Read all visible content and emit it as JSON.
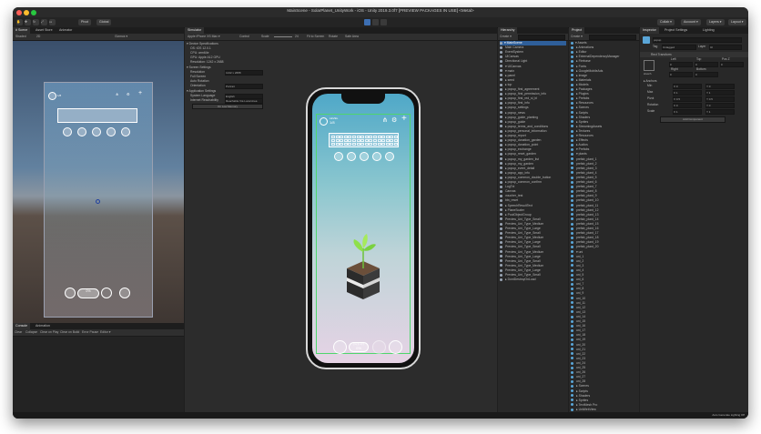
{
  "window": {
    "title": "MainScene - SolarPlanet_UnityWork - iOS - Unity 2019.3.0f7 [PREVIEW PACKAGES IN USE] <Metal>"
  },
  "toolbar": {
    "pivot": "Pivot",
    "global": "Global",
    "collab": "Collab ▾",
    "account": "Account ▾",
    "layers": "Layers ▾",
    "layout": "Layout ▾"
  },
  "scene_tabs": [
    "# Scene",
    "Asset Store",
    "Animator"
  ],
  "scene_sub": {
    "shaded": "Shaded",
    "mode": "2D",
    "gizmos": "Gizmos ▾"
  },
  "game_panel": {
    "tab": "Simulator",
    "device": "Apple iPhone XS Max ▾",
    "control": "Control",
    "scale_label": "Scale",
    "scale_value": "24",
    "fit_label": "Fit to Screen",
    "rotate": "Rotate",
    "safe_area": "Safe Area",
    "section_spec": "▾ Device Specifications",
    "specs": [
      "OS: iOS 12.0.1",
      "CPU: arm64e",
      "GPU: Apple A12 GPU",
      "Resolution: 1242 x 2688"
    ],
    "section_screen": "▾ Screen Settings",
    "screen_rows": [
      {
        "k": "Resolution",
        "v": "1242 x 2688"
      },
      {
        "k": "Full Screen",
        "v": ""
      },
      {
        "k": "Auto Rotation",
        "v": ""
      },
      {
        "k": "Orientation",
        "v": "Portrait"
      }
    ],
    "section_app": "▾ Application Settings",
    "app_rows": [
      {
        "k": "System Language",
        "v": "English"
      },
      {
        "k": "Internet Reachability",
        "v": "Reachable Via Local Area"
      }
    ],
    "low_memory": "On Low Memory"
  },
  "hierarchy": {
    "tab": "Hierarchy",
    "create": "Create ▾",
    "items": [
      "▾ MainScene",
      "  Main Camera",
      "  EventSystem",
      "  UICanvas",
      "  Directional Light",
      "  ▾ UICanvas",
      "    ▾ main",
      "      ▸ panel",
      "      ▸ seed",
      "      ▸ top",
      "      ▸ popup_first_agreement",
      "      ▸ popup_first_permission_info",
      "      ▸ popup_first_red_sl_bl",
      "      ▸ popup_first_info",
      "      ▸ popup_settings",
      "      ▸ popup_news",
      "      ▸ popup_guide_planting",
      "      ▸ popup_guide",
      "      ▸ popup_terms_and_conditions",
      "      ▸ popup_personal_information",
      "      ▸ popup_report",
      "      ▸ popup_donation_garden",
      "      ▸ popup_donation_point",
      "      ▸ popup_exchange",
      "      ▸ popup_reset_garden",
      "      ▸ popup_my_garden_list",
      "      ▸ popup_my_garden",
      "      ▸ popup_event_detail",
      "      ▸ popup_app_info",
      "      ▸ popup_common_double_button",
      "      ▸ popup_common_confirm",
      "      LogTxt",
      "    Canvas",
      "      voucher_test",
      "      btn_reset",
      "  ▸ SpeechResultText",
      "  ▸ PlaneScaler",
      "  ▸ PoolObjectGroup",
      "    Preview_Uni_Type_Small",
      "    Preview_Uni_Type_Medium",
      "    Preview_Uni_Type_Large",
      "    Preview_Uni_Type_Small",
      "    Preview_Uni_Type_Medium",
      "    Preview_Uni_Type_Large",
      "    Preview_Uni_Type_Small",
      "    Preview_Uni_Type_Medium",
      "    Preview_Uni_Type_Large",
      "    Preview_Uni_Type_Small",
      "    Preview_Uni_Type_Medium",
      "    Preview_Uni_Type_Large",
      "    Preview_Uni_Type_Small",
      "  ▸ DontDestroyOnLoad"
    ]
  },
  "project": {
    "tab": "Project",
    "create": "Create ▾",
    "items": [
      "▾ Assets",
      "  ▸ Animations",
      "  ▸ Editor",
      "  ▸ ExternalDependencyManager",
      "  ▸ Firebase",
      "  ▸ Fonts",
      "  ▸ GoogleMobileAds",
      "  ▸ Image",
      "  ▸ Materials",
      "  ▸ Models",
      "  ▸ Packages",
      "  ▸ Plugins",
      "  ▸ Prefabs",
      "  ▸ Resources",
      "  ▸ Scenes",
      "  ▸ Scripts",
      "  ▸ Shaders",
      "  ▸ Sprites",
      "  ▸ StreamingAssets",
      "  ▸ Textures",
      "  ▾ Resources",
      "    ▸ Effects",
      "    ▸ Audios",
      "    ▾ Prefabs",
      "      ▾ plants",
      "        prefab_plant_1",
      "        prefab_plant_2",
      "        prefab_plant_3",
      "        prefab_plant_4",
      "        prefab_plant_5",
      "        prefab_plant_6",
      "        prefab_plant_7",
      "        prefab_plant_8",
      "        prefab_plant_9",
      "        prefab_plant_10",
      "        prefab_plant_11",
      "        prefab_plant_12",
      "        prefab_plant_13",
      "        prefab_plant_14",
      "        prefab_plant_15",
      "        prefab_plant_16",
      "        prefab_plant_17",
      "        prefab_plant_18",
      "        prefab_plant_19",
      "        prefab_plant_20",
      "      ▾ uni",
      "        uni_1",
      "        uni_2",
      "        uni_3",
      "        uni_4",
      "        uni_5",
      "        uni_6",
      "        uni_7",
      "        uni_8",
      "        uni_9",
      "        uni_10",
      "        uni_11",
      "        uni_12",
      "        uni_13",
      "        uni_14",
      "        uni_15",
      "        uni_16",
      "        uni_17",
      "        uni_18",
      "        uni_19",
      "        uni_20",
      "        uni_21",
      "        uni_22",
      "        uni_23",
      "        uni_24",
      "        uni_25",
      "        uni_26",
      "        uni_27",
      "        uni_28",
      "    ▸ Scenes",
      "    ▸ Scripts",
      "    ▸ Shaders",
      "    ▸ Sprites",
      "    ▸ TextMesh Pro",
      "    ▸ UniWebView",
      "  ▸ google-services-desktop",
      "▸ Packages"
    ]
  },
  "inspector": {
    "tabs": [
      "Inspector",
      "Project Settings",
      "Lighting"
    ],
    "object_name": "popup",
    "tag_label": "Tag",
    "tag_value": "Untagged",
    "layer_label": "Layer",
    "layer_value": "UI",
    "component": "Rect Transform",
    "stretch": "stretch",
    "cols": [
      "Left",
      "Top",
      "Pos Z"
    ],
    "vals1": [
      "0",
      "0",
      "0"
    ],
    "cols2": [
      "Right",
      "Bottom"
    ],
    "vals2": [
      "0",
      "0"
    ],
    "anchors": "▸ Anchors",
    "rows": [
      {
        "k": "Min",
        "x": "X 0",
        "y": "Y 0"
      },
      {
        "k": "Max",
        "x": "X 1",
        "y": "Y 1"
      },
      {
        "k": "Pivot",
        "x": "X 0.5",
        "y": "Y 0.5"
      },
      {
        "k": "Rotation",
        "x": "X 0",
        "y": "Y 0"
      },
      {
        "k": "Scale",
        "x": "X 1",
        "y": "Y 1"
      }
    ],
    "add_component": "Add Component"
  },
  "console": {
    "tabs": [
      "Console",
      "Animation"
    ],
    "buttons": [
      "Clear",
      "Collapse",
      "Clear on Play",
      "Clear on Build",
      "Error Pause",
      "Editor ▾"
    ]
  },
  "status": {
    "right": "Auto Generate Lighting Off"
  },
  "app_ui": {
    "settings_symbol": "⚙",
    "share_symbol": "⋔",
    "plus_symbol": "+",
    "level_small": "LEVEL",
    "level_val": "1/8",
    "gauge_top": "잔디물 지수",
    "gauge_value": "0%"
  },
  "colors": {
    "accent": "#3d6fb3",
    "safe_area": "#4fd66c",
    "panel": "#282828",
    "bg": "#1f1f1f"
  }
}
